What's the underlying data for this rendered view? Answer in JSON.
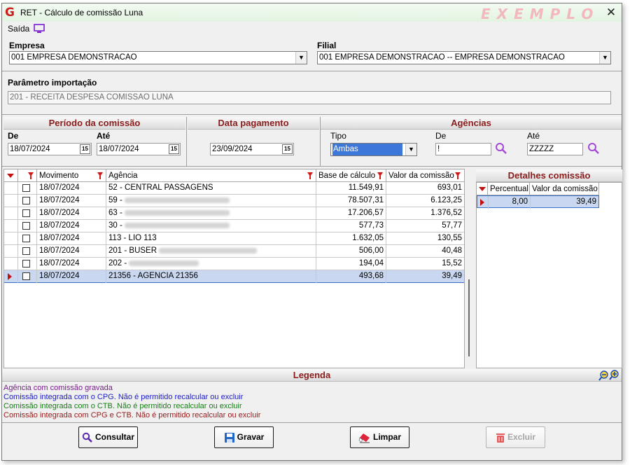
{
  "window": {
    "title": "RET - Cálculo de comissão Luna",
    "watermark": "EXEMPLO",
    "close": "✕"
  },
  "menu": {
    "saida": "Saída"
  },
  "empresa": {
    "label": "Empresa",
    "value": "001 EMPRESA DEMONSTRACAO"
  },
  "filial": {
    "label": "Filial",
    "value": "001 EMPRESA DEMONSTRACAO -- EMPRESA DEMONSTRACAO"
  },
  "parametro": {
    "label": "Parâmetro importação",
    "value": "201 - RECEITA DESPESA COMISSAO LUNA"
  },
  "periodo": {
    "title": "Período da comissão",
    "de_label": "De",
    "ate_label": "Até",
    "de": "18/07/2024",
    "ate": "18/07/2024"
  },
  "pagamento": {
    "title": "Data pagamento",
    "value": "23/09/2024"
  },
  "agencias": {
    "title": "Agências",
    "tipo_label": "Tipo",
    "tipo": "Ambas",
    "de_label": "De",
    "de": "!",
    "ate_label": "Até",
    "ate": "ZZZZZ"
  },
  "calendar_glyph": "15",
  "grid": {
    "headers": [
      "Movimento",
      "Agência",
      "Base de cálculo",
      "Valor da comissão"
    ],
    "rows": [
      {
        "movimento": "18/07/2024",
        "agencia": "52 - CENTRAL PASSAGENS",
        "base": "11.549,91",
        "valor": "693,01"
      },
      {
        "movimento": "18/07/2024",
        "agencia": "59 -",
        "base": "78.507,31",
        "valor": "6.123,25"
      },
      {
        "movimento": "18/07/2024",
        "agencia": "63 -",
        "base": "17.206,57",
        "valor": "1.376,52"
      },
      {
        "movimento": "18/07/2024",
        "agencia": "30 -",
        "base": "577,73",
        "valor": "57,77"
      },
      {
        "movimento": "18/07/2024",
        "agencia": "113 - LIO 113",
        "base": "1.632,05",
        "valor": "130,55"
      },
      {
        "movimento": "18/07/2024",
        "agencia": "201 - BUSER",
        "base": "506,00",
        "valor": "40,48"
      },
      {
        "movimento": "18/07/2024",
        "agencia": "202 -",
        "base": "194,04",
        "valor": "15,52"
      },
      {
        "movimento": "18/07/2024",
        "agencia": "21356 - AGENCIA 21356",
        "base": "493,68",
        "valor": "39,49"
      }
    ]
  },
  "detalhes": {
    "title": "Detalhes comissão",
    "headers": [
      "Percentual",
      "Valor da comissão"
    ],
    "row": {
      "percentual": "8,00",
      "valor": "39,49"
    }
  },
  "legenda": {
    "title": "Legenda",
    "items": [
      {
        "text": "Agência com comissão gravada",
        "color": "#7a1f8f"
      },
      {
        "text": "Comissão integrada com o CPG. Não é permitido recalcular ou excluir",
        "color": "#1c1cc8"
      },
      {
        "text": "Comissão integrada com o CTB. Não é permitido recalcular ou excluir",
        "color": "#1a7a1a"
      },
      {
        "text": "Comissão integrada com CPG e CTB. Não é permitido recalcular ou excluir",
        "color": "#9a1818"
      }
    ]
  },
  "buttons": {
    "consultar": "Consultar",
    "gravar": "Gravar",
    "limpar": "Limpar",
    "excluir": "Excluir"
  }
}
